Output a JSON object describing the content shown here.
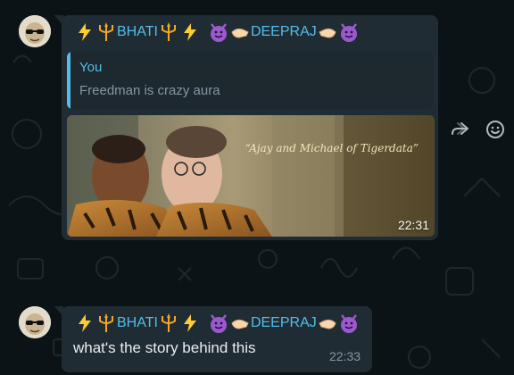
{
  "colors": {
    "background": "#0c1317",
    "bubble": "#202c33",
    "quote_bg": "#1d282f",
    "accent": "#53bdeb",
    "text": "#e9edef",
    "meta": "#8696a0"
  },
  "messages": [
    {
      "sender": {
        "emoji_left": [
          "lightning-icon",
          "trident-icon"
        ],
        "part1": "BHATI",
        "emoji_mid": [
          "trident-icon",
          "lightning-icon",
          "devil-icon",
          "handshake-left-icon"
        ],
        "part2": "DEEPRAJ",
        "emoji_right": [
          "handshake-right-icon",
          "devil-icon"
        ]
      },
      "quote": {
        "author": "You",
        "text": "Freedman is crazy aura"
      },
      "photo": {
        "caption": "“Ajay and Michael of Tigerdata”",
        "time": "22:31"
      },
      "actions": [
        "forward-icon",
        "emoji-react-icon"
      ]
    },
    {
      "sender": {
        "part1": "BHATI",
        "part2": "DEEPRAJ"
      },
      "text": "what's the story behind this",
      "time": "22:33"
    }
  ]
}
